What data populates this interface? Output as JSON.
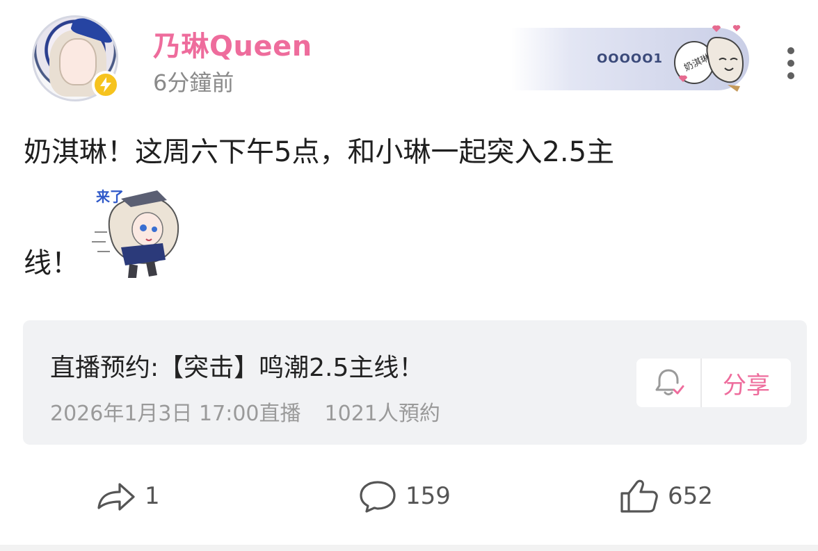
{
  "post": {
    "author": {
      "name": "乃琳Queen",
      "verified_badge_icon": "lightning-icon",
      "avatar_icon": "character-avatar"
    },
    "time": "6分鐘前",
    "fan_badge": {
      "code": "OOOOO1",
      "sticker_text": "奶淇琳"
    },
    "text_line1": "奶淇琳！这周六下午5点，和小琳一起突入2.5主",
    "text_line2": "线！",
    "sticker_text": "来了"
  },
  "live_card": {
    "title": "直播预约:【突击】鸣潮2.5主线！",
    "schedule": "2026年1月3日 17:00直播",
    "reservations": "1021人預約",
    "bell_icon": "bell-check-icon",
    "share_label": "分享"
  },
  "actions": {
    "forward_count": "1",
    "comment_count": "159",
    "like_count": "652"
  },
  "colors": {
    "accent": "#ee6c9c",
    "verified": "#f6c31e",
    "card_bg": "#f1f2f4"
  }
}
